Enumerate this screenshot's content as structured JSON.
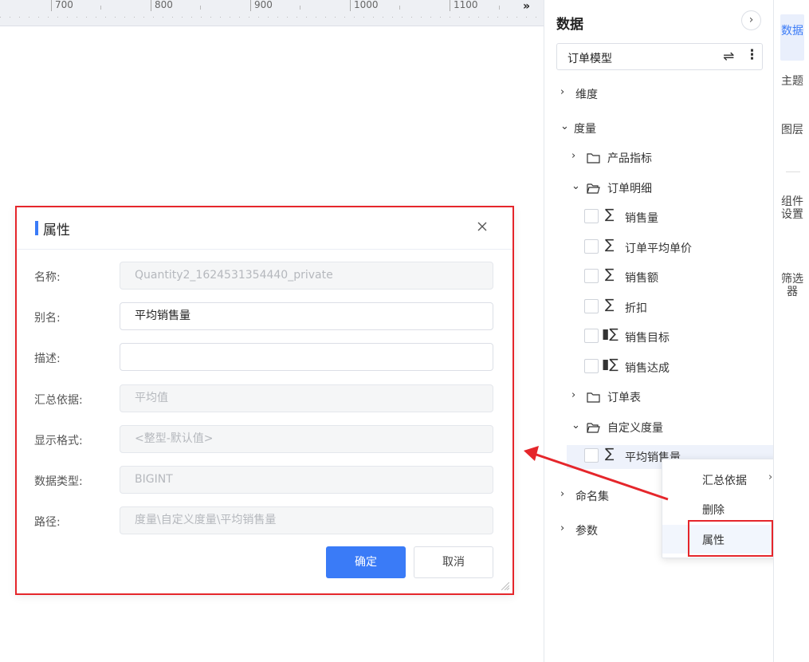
{
  "ruler": {
    "ticks": [
      "700",
      "800",
      "900",
      "1000",
      "1100"
    ],
    "collapse_glyph": "»"
  },
  "dialog": {
    "title": "属性",
    "fields": [
      {
        "label": "名称:",
        "value": "Quantity2_1624531354440_private",
        "disabled": true
      },
      {
        "label": "别名:",
        "value": "平均销售量",
        "disabled": false
      },
      {
        "label": "描述:",
        "value": "",
        "disabled": false
      },
      {
        "label": "汇总依据:",
        "value": "平均值",
        "disabled": true
      },
      {
        "label": "显示格式:",
        "value": "<整型-默认值>",
        "disabled": true
      },
      {
        "label": "数据类型:",
        "value": "BIGINT",
        "disabled": true
      },
      {
        "label": "路径:",
        "value": "度量\\自定义度量\\平均销售量",
        "disabled": true
      }
    ],
    "ok_label": "确定",
    "cancel_label": "取消"
  },
  "data_panel": {
    "title": "数据",
    "collapse_glyph": "›",
    "model_name": "订单模型",
    "tree": {
      "dimension": "维度",
      "measure": "度量",
      "product_metrics": "产品指标",
      "order_detail": "订单明细",
      "fields": [
        "销售量",
        "订单平均单价",
        "销售额",
        "折扣",
        "销售目标",
        "销售达成"
      ],
      "order_table": "订单表",
      "custom_measure": "自定义度量",
      "custom_field": "平均销售量",
      "named_set": "命名集",
      "params": "参数"
    }
  },
  "context_menu": {
    "items": [
      {
        "label": "汇总依据",
        "has_submenu": true
      },
      {
        "label": "删除",
        "has_submenu": false
      },
      {
        "label": "属性",
        "has_submenu": false
      }
    ]
  },
  "right_tabs": [
    "数据",
    "主题",
    "图层",
    "组件设置",
    "筛选器"
  ],
  "colors": {
    "accent": "#3a7bf7",
    "annotation_red": "#e5262b"
  }
}
